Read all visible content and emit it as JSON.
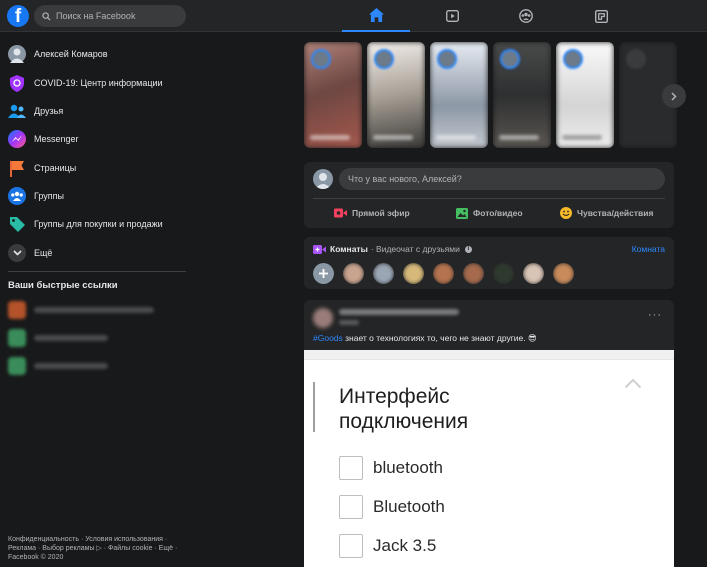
{
  "app": {
    "logo_letter": "f",
    "search_placeholder": "Поиск на Facebook",
    "nav_tabs": [
      {
        "icon": "home-icon",
        "active": true
      },
      {
        "icon": "watch-icon",
        "active": false
      },
      {
        "icon": "groups-icon",
        "active": false
      },
      {
        "icon": "gaming-icon",
        "active": false
      }
    ]
  },
  "sidebar": {
    "items": [
      {
        "label": "Алексей Комаров",
        "icon": "profile-avatar"
      },
      {
        "label": "COVID-19: Центр информации",
        "icon": "covid-shield-icon"
      },
      {
        "label": "Друзья",
        "icon": "friends-icon"
      },
      {
        "label": "Messenger",
        "icon": "messenger-icon"
      },
      {
        "label": "Страницы",
        "icon": "pages-flag-icon"
      },
      {
        "label": "Группы",
        "icon": "groups-icon"
      },
      {
        "label": "Группы для покупки и продажи",
        "icon": "buy-sell-tag-icon"
      },
      {
        "label": "Ещё",
        "icon": "chevron-down-icon"
      }
    ],
    "shortcuts_title": "Ваши быстрые ссылки",
    "footer": "Конфиденциальность · Условия использования · Реклама · Выбор рекламы ▷ · Файлы cookie · Ещё · Facebook © 2020"
  },
  "composer": {
    "placeholder": "Что у вас нового, Алексей?",
    "actions": [
      {
        "label": "Прямой эфир",
        "icon": "live-video-icon",
        "color": "#f3425f"
      },
      {
        "label": "Фото/видео",
        "icon": "photo-icon",
        "color": "#45bd62"
      },
      {
        "label": "Чувства/действия",
        "icon": "feeling-icon",
        "color": "#f7b928"
      }
    ]
  },
  "rooms": {
    "title": "Комнаты",
    "subtitle": "· Видеочат с друзьями",
    "info": "i",
    "create_button": "Комната"
  },
  "post": {
    "more": "···",
    "hashtag": "#Goods",
    "text": " знает о технологиях то, чего не знают другие. 😎",
    "image": {
      "heading_line1": "Интерфейс",
      "heading_line2": "подключения",
      "options": [
        "bluetooth",
        "Bluetooth",
        "Jack 3.5"
      ]
    }
  },
  "colors": {
    "accent": "#2d88ff",
    "background": "#18191a",
    "surface": "#242526",
    "input": "#3a3b3c"
  }
}
